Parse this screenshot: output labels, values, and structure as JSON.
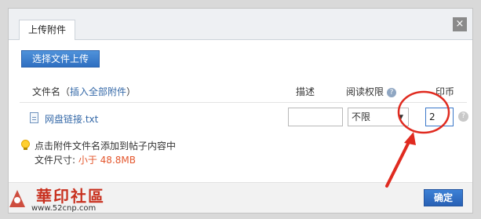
{
  "dialog": {
    "tab_label": "上传附件",
    "close_symbol": "×",
    "upload_button": "选择文件上传",
    "ok_button": "确定"
  },
  "table": {
    "header_file_prefix": "文件名（",
    "header_insert_all": "插入全部附件",
    "header_file_suffix": "）",
    "header_desc": "描述",
    "header_permission": "阅读权限",
    "header_price": "印币",
    "help_symbol": "?"
  },
  "attachment": {
    "file_name": "网盘链接.txt",
    "description": "",
    "permission": "不限",
    "price": "2"
  },
  "tip": {
    "text": "点击附件文件名添加到帖子内容中",
    "size_label": "文件尺寸: ",
    "size_value": "小于 48.8MB"
  },
  "watermark": {
    "title": "華印社區",
    "url": "www.52cnp.com"
  },
  "colors": {
    "primary_blue": "#2f6fc1",
    "annotation_red": "#e02b20",
    "size_orange": "#e4572e"
  }
}
